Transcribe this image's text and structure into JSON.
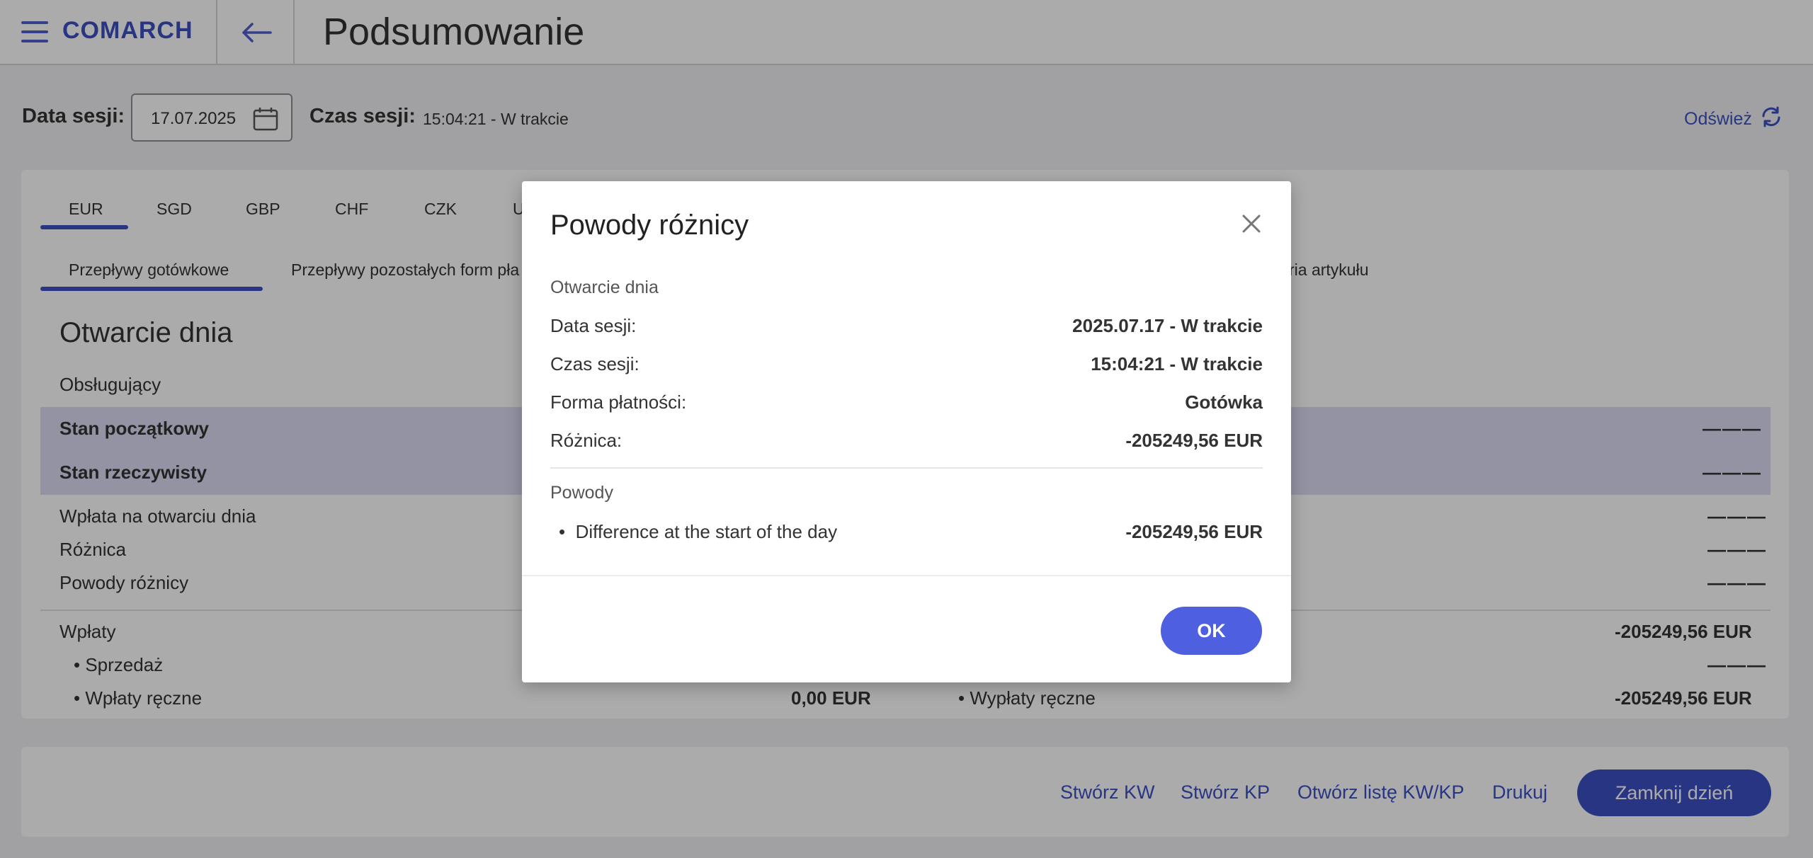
{
  "header": {
    "brand": "COMARCH",
    "title": "Podsumowanie"
  },
  "session": {
    "date_label": "Data sesji:",
    "date_value": "17.07.2025",
    "time_label": "Czas sesji:",
    "time_value": "15:04:21 - W trakcie",
    "refresh_label": "Odśwież"
  },
  "currency_tabs": [
    "EUR",
    "SGD",
    "GBP",
    "CHF",
    "CZK",
    "U"
  ],
  "sub_tabs": {
    "cash_flows": "Przepływy gotówkowe",
    "other_forms": "Przepływy pozostałych form pła",
    "article": "ria artykułu"
  },
  "summary": {
    "section_title": "Otwarcie dnia",
    "operator": "Obsługujący",
    "initial_state": "Stan początkowy",
    "actual_state": "Stan rzeczywisty",
    "opening_deposit": "Wpłata na otwarciu dnia",
    "difference": "Różnica",
    "difference_reasons": "Powody różnicy",
    "deposits": "Wpłaty",
    "sale": "Sprzedaż",
    "manual_deposits": "Wpłaty ręczne",
    "manual_deposits_value": "0,00 EUR",
    "manual_withdrawals": "Wypłaty ręczne",
    "deposits_total": "-205249,56 EUR",
    "withdrawals_total": "-205249,56 EUR",
    "dash": "———"
  },
  "bottom_actions": {
    "create_kw": "Stwórz KW",
    "create_kp": "Stwórz KP",
    "open_list": "Otwórz listę KW/KP",
    "print": "Drukuj",
    "close_day": "Zamknij dzień"
  },
  "modal": {
    "title": "Powody różnicy",
    "section_opening": "Otwarcie dnia",
    "rows": [
      {
        "label": "Data sesji:",
        "value": "2025.07.17 - W trakcie"
      },
      {
        "label": "Czas sesji:",
        "value": "15:04:21 - W trakcie"
      },
      {
        "label": "Forma płatności:",
        "value": "Gotówka"
      },
      {
        "label": "Różnica:",
        "value": "-205249,56 EUR"
      }
    ],
    "section_reasons": "Powody",
    "reason_label": "Difference at the start of the day",
    "reason_value": "-205249,56 EUR",
    "ok_label": "OK"
  },
  "colors": {
    "accent": "#3d4fc4",
    "highlight_row": "#dcdcf4",
    "ok_button": "#4e5fe0"
  }
}
